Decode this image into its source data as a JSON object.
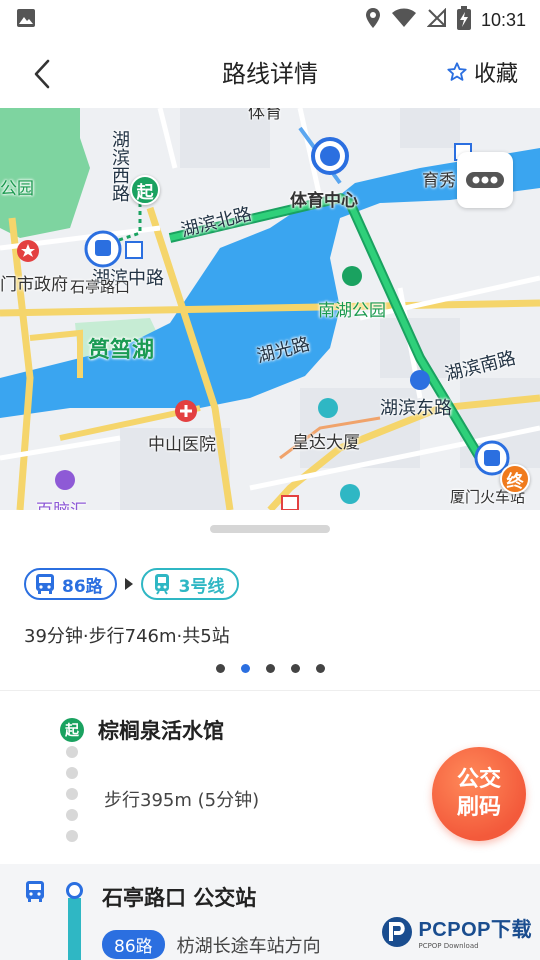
{
  "status_bar": {
    "time": "10:31"
  },
  "header": {
    "title": "路线详情",
    "favorite_label": "收藏"
  },
  "map": {
    "labels": {
      "park_left": "公园",
      "huxin_road": "湖滨北路",
      "huxin_zhong": "湖滨中路",
      "shiting": "石亭路口",
      "city_gov": "门市政府",
      "lake": "筼筜湖",
      "tiyu": "体育中心",
      "yuxiu": "育秀",
      "nanhu_park": "南湖公园",
      "huguang": "湖光路",
      "hubin_south": "湖滨南路",
      "hubin_east": "湖滨东路",
      "zhongshan": "中山医院",
      "huangda": "皇达大厦",
      "xiamen_station": "厦门火车站",
      "huxi_vertical": "湖滨西路",
      "bainaohui": "百脑汇",
      "top_partial": "体育"
    },
    "start_marker": "起",
    "end_marker": "终"
  },
  "route": {
    "segments": [
      {
        "type": "bus",
        "label": "86路"
      },
      {
        "type": "metro",
        "label": "3号线"
      }
    ],
    "summary": "39分钟·步行746m·共5站",
    "page_count": 5,
    "active_page": 2
  },
  "steps": {
    "start_icon": "起",
    "start_name": "棕榈泉活水馆",
    "walk_text": "步行395m (5分钟)",
    "stop_name": "石亭路口 公交站",
    "line": "86路",
    "direction": "枋湖长途车站方向"
  },
  "fab": {
    "line1": "公交",
    "line2": "刷码"
  },
  "watermark": {
    "brand": "PCPOP下载",
    "sub": "PCPOP Download"
  },
  "colors": {
    "accent": "#2b6fe0",
    "metro": "#2fb7c4",
    "route_green": "#1aa260",
    "fab": "#f35a3b"
  }
}
